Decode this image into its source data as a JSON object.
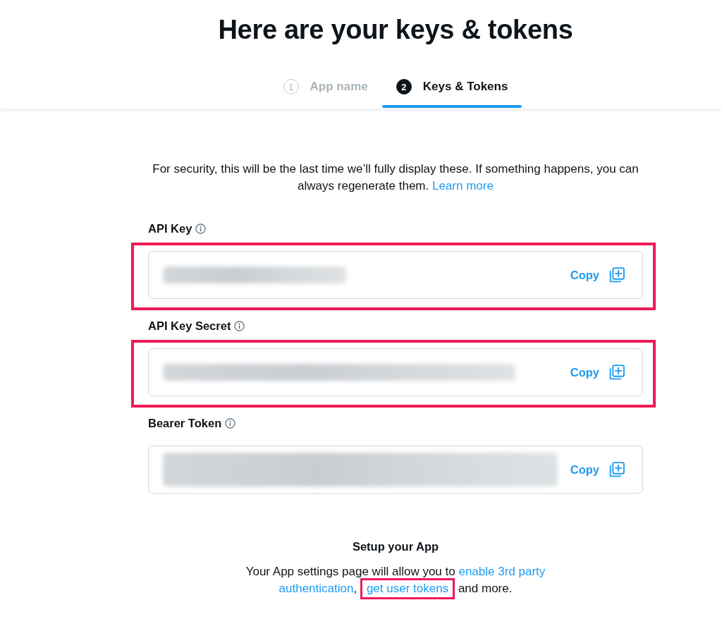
{
  "page_title": "Here are your keys & tokens",
  "steps": [
    {
      "number": "1",
      "label": "App name",
      "selected": false
    },
    {
      "number": "2",
      "label": "Keys & Tokens",
      "selected": true
    }
  ],
  "notice": {
    "text": "For security, this will be the last time we’ll fully display these. If something happens, you can always regenerate them. ",
    "link": "Learn more"
  },
  "credentials": [
    {
      "label": "API Key",
      "copy": "Copy",
      "highlighted": true
    },
    {
      "label": "API Key Secret",
      "copy": "Copy",
      "highlighted": true
    },
    {
      "label": "Bearer Token",
      "copy": "Copy",
      "highlighted": false
    }
  ],
  "setup": {
    "title": "Setup your App",
    "parts": [
      {
        "kind": "text",
        "text": "Your App settings page will allow you to "
      },
      {
        "kind": "link",
        "text": "enable 3rd party",
        "highlighted": false
      },
      {
        "kind": "link",
        "text": "authentication",
        "highlighted": false
      },
      {
        "kind": "text",
        "text": ", "
      },
      {
        "kind": "link",
        "text": "get user tokens",
        "highlighted": true
      },
      {
        "kind": "text",
        "text": " and more."
      }
    ]
  }
}
